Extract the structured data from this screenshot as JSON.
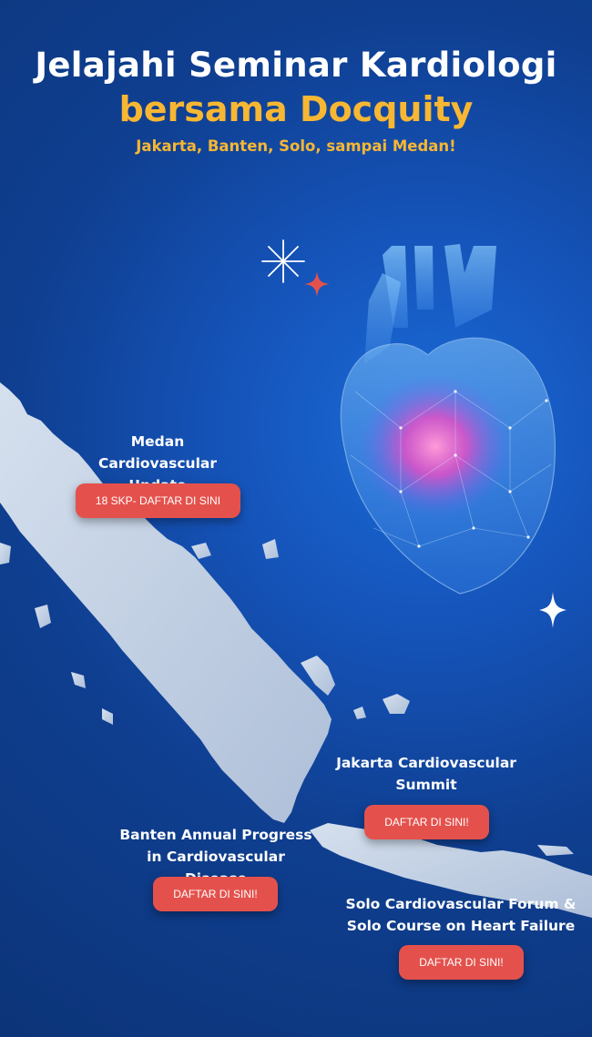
{
  "header": {
    "title_line1": "Jelajahi Seminar Kardiologi",
    "title_line2": "bersama Docquity",
    "subtitle": "Jakarta, Banten, Solo, sampai Medan!"
  },
  "events": [
    {
      "title": "Medan Cardiovascular Update",
      "cta": "18 SKP- DAFTAR DI SINI"
    },
    {
      "title": "Jakarta Cardiovascular Summit",
      "cta": "DAFTAR DI SINI!"
    },
    {
      "title": "Banten Annual Progress in Cardiovascular Disease",
      "cta": "DAFTAR DI SINI!"
    },
    {
      "title": "Solo Cardiovascular Forum & Solo Course on Heart Failure",
      "cta": "DAFTAR DI SINI!"
    }
  ],
  "colors": {
    "background": "#0f3f91",
    "accent_yellow": "#f7b733",
    "button_red": "#e4514c",
    "map_fill": "#c4d3e6"
  },
  "icons": [
    "sparkle-icon",
    "star-icon",
    "heart-illustration"
  ]
}
